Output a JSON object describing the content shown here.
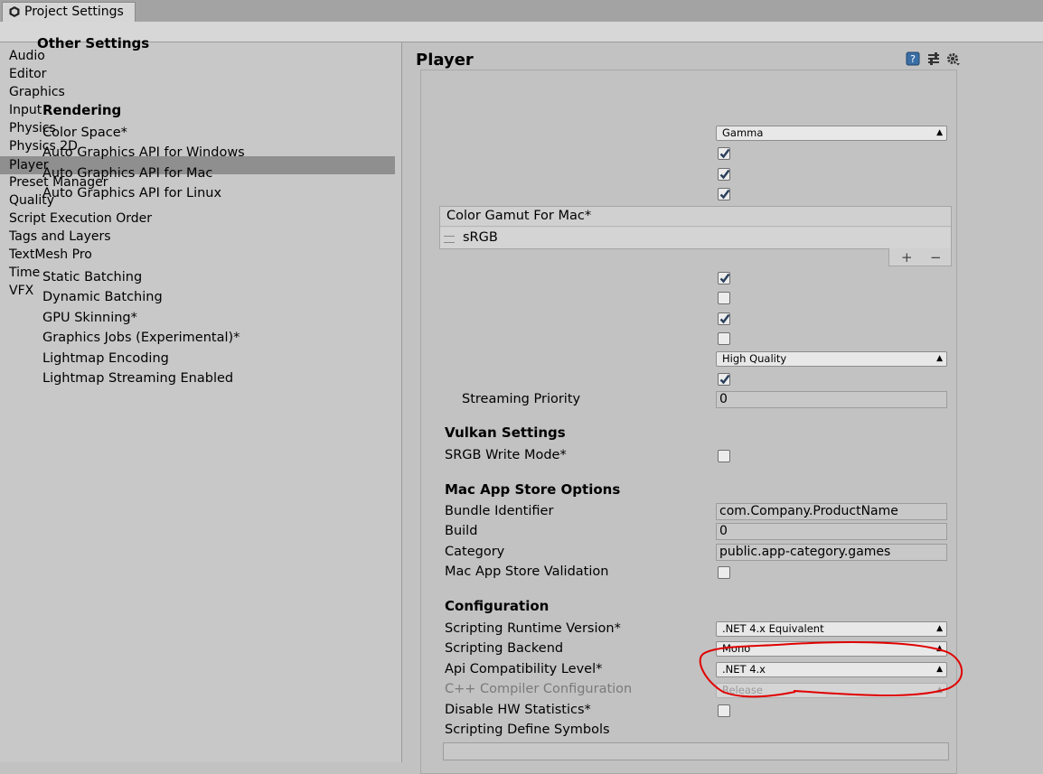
{
  "window": {
    "tab_title": "Project Settings"
  },
  "sidebar": {
    "items": [
      {
        "label": "Audio"
      },
      {
        "label": "Editor"
      },
      {
        "label": "Graphics"
      },
      {
        "label": "Input"
      },
      {
        "label": "Physics"
      },
      {
        "label": "Physics 2D"
      },
      {
        "label": "Player",
        "selected": true
      },
      {
        "label": "Preset Manager"
      },
      {
        "label": "Quality"
      },
      {
        "label": "Script Execution Order"
      },
      {
        "label": "Tags and Layers"
      },
      {
        "label": "TextMesh Pro"
      },
      {
        "label": "Time"
      },
      {
        "label": "VFX"
      }
    ]
  },
  "header": {
    "title": "Player",
    "icons": [
      "help-icon",
      "preset-icon",
      "settings-gear-icon"
    ]
  },
  "panel": {
    "section_title": "Other Settings",
    "rendering": {
      "title": "Rendering",
      "color_space": {
        "label": "Color Space*",
        "value": "Gamma"
      },
      "auto_gfx_windows": {
        "label": "Auto Graphics API  for Windows",
        "checked": true
      },
      "auto_gfx_mac": {
        "label": "Auto Graphics API  for Mac",
        "checked": true
      },
      "auto_gfx_linux": {
        "label": "Auto Graphics API  for Linux",
        "checked": true
      },
      "color_gamut": {
        "header": "Color Gamut For Mac*",
        "items": [
          "sRGB"
        ],
        "add_label": "+",
        "remove_label": "−"
      },
      "static_batching": {
        "label": "Static Batching",
        "checked": true
      },
      "dynamic_batching": {
        "label": "Dynamic Batching",
        "checked": false
      },
      "gpu_skinning": {
        "label": "GPU Skinning*",
        "checked": true
      },
      "graphics_jobs": {
        "label": "Graphics Jobs (Experimental)*",
        "checked": false
      },
      "lightmap_encoding": {
        "label": "Lightmap Encoding",
        "value": "High Quality"
      },
      "lightmap_streaming": {
        "label": "Lightmap Streaming Enabled",
        "checked": true
      },
      "streaming_priority": {
        "label": "Streaming Priority",
        "value": "0"
      }
    },
    "vulkan": {
      "title": "Vulkan Settings",
      "srgb_write_mode": {
        "label": "SRGB Write Mode*",
        "checked": false
      }
    },
    "mac_app_store": {
      "title": "Mac App Store Options",
      "bundle_identifier": {
        "label": "Bundle Identifier",
        "value": "com.Company.ProductName"
      },
      "build": {
        "label": "Build",
        "value": "0"
      },
      "category": {
        "label": "Category",
        "value": "public.app-category.games"
      },
      "validation": {
        "label": "Mac App Store Validation",
        "checked": false
      }
    },
    "configuration": {
      "title": "Configuration",
      "runtime_version": {
        "label": "Scripting Runtime Version*",
        "value": ".NET 4.x Equivalent"
      },
      "scripting_backend": {
        "label": "Scripting Backend",
        "value": "Mono"
      },
      "api_compat": {
        "label": "Api Compatibility Level*",
        "value": ".NET 4.x"
      },
      "cpp_compiler": {
        "label": "C++ Compiler Configuration",
        "value": "Release",
        "disabled": true
      },
      "disable_hw_stats": {
        "label": "Disable HW Statistics*",
        "checked": false
      },
      "define_symbols": {
        "label": "Scripting Define Symbols",
        "value": ""
      }
    }
  },
  "colors": {
    "background": "#c2c2c2",
    "selected_row": "#8f8f8f",
    "check_tick": "#2a3f5c",
    "annotation": "#e00000"
  }
}
